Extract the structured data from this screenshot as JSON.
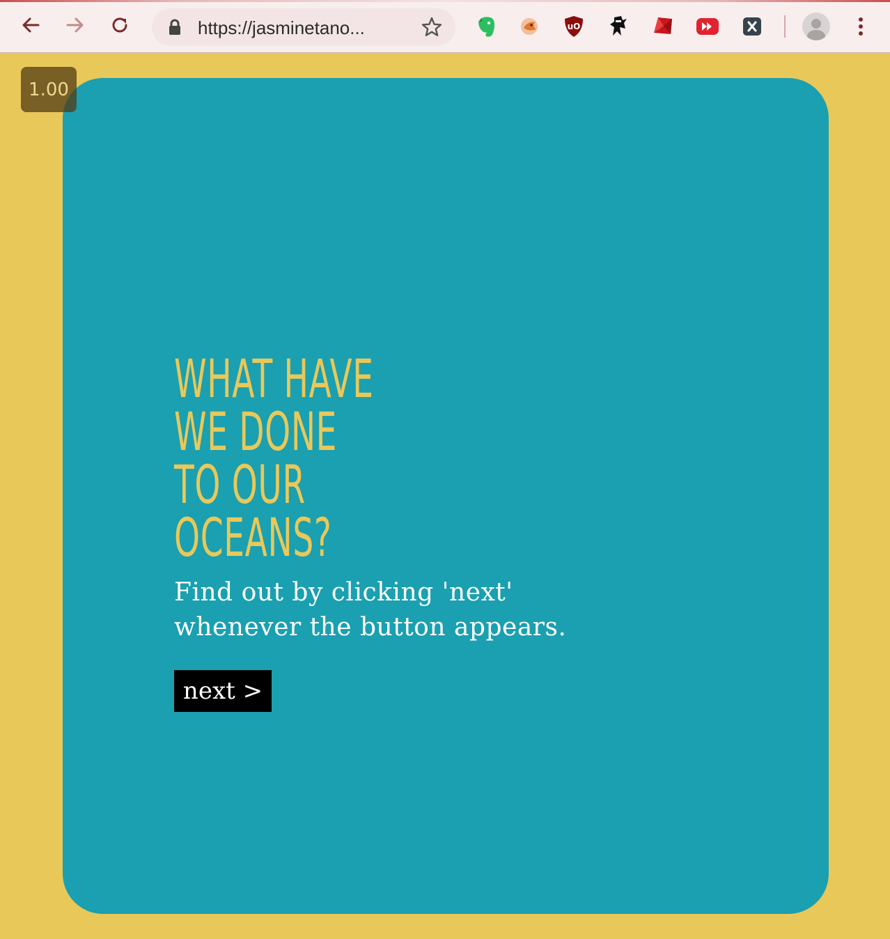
{
  "browser": {
    "url": "https://jasminetano...",
    "icons": {
      "back": "back-arrow-icon",
      "forward": "forward-arrow-icon",
      "reload": "reload-icon",
      "lock": "lock-icon",
      "star": "bookmark-star-icon",
      "menu": "kebab-menu-icon"
    },
    "extensions": [
      "evernote-icon",
      "orange-bird-icon",
      "ublock-origin-icon",
      "ninja-icon",
      "ruby-icon",
      "fast-forward-icon",
      "x-square-icon"
    ],
    "accent_color": "#c94f4f"
  },
  "page": {
    "zoom_badge": "1.00",
    "headline": [
      "WHAT HAVE",
      "WE DONE",
      "TO OUR",
      "OCEANS?"
    ],
    "subtext": [
      "Find out by clicking 'next'",
      "whenever the button appears."
    ],
    "next_label": "next >",
    "colors": {
      "background": "#e9c85a",
      "card": "#1aa0b0",
      "headline": "#e9c85a",
      "button": "#000000"
    }
  }
}
